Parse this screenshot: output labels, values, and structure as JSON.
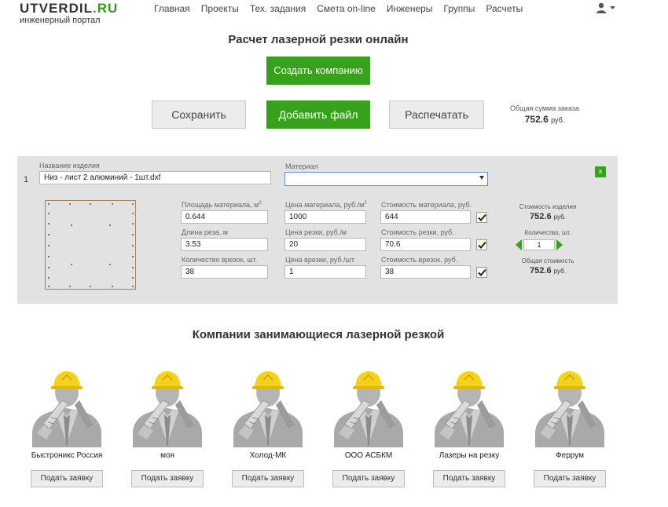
{
  "header": {
    "logo_main": "UTVERDIL",
    "logo_tld": ".RU",
    "logo_sub": "инженерный портал",
    "nav": [
      "Главная",
      "Проекты",
      "Тех. задания",
      "Смета on-line",
      "Инженеры",
      "Группы",
      "Расчеты"
    ]
  },
  "page_title": "Расчет лазерной резки онлайн",
  "buttons": {
    "create_company": "Создать компанию",
    "save": "Сохранить",
    "add_file": "Добавить файл",
    "print": "Распечатать"
  },
  "order_total": {
    "label": "Общая сумма заказа",
    "value": "752.6",
    "unit": "руб."
  },
  "item": {
    "number": "1",
    "name_label": "Название изделия",
    "name_value": "Низ - лист 2 алюминий - 1шт.dxf",
    "material_label": "Материал",
    "material_value": "",
    "close_label": "x",
    "area_label": "Площадь материала, м",
    "area_label_sup": "2",
    "area_value": "0.644",
    "cut_length_label": "Длина реза, м",
    "cut_length_value": "3.53",
    "pierce_count_label": "Количество врезок, шт.",
    "pierce_count_value": "38",
    "material_price_label": "Цена материала, руб./м",
    "material_price_label_sup": "2",
    "material_price_value": "1000",
    "cut_price_label": "Цена резки, руб./м",
    "cut_price_value": "20",
    "pierce_price_label": "Цена врезки, руб./шт.",
    "pierce_price_value": "1",
    "material_cost_label": "Стоимость материала, руб.",
    "material_cost_value": "644",
    "cut_cost_label": "Стоимость резки, руб.",
    "cut_cost_value": "70.6",
    "pierce_cost_label": "Стоимость врезок, руб.",
    "pierce_cost_value": "38",
    "item_cost_label": "Стоимость изделия",
    "item_cost_value": "752.6",
    "quantity_label": "Количество, шт.",
    "quantity_value": "1",
    "total_cost_label": "Общая стоимость",
    "total_cost_value": "752.6",
    "unit": "руб."
  },
  "companies_title": "Компании занимающиеся лазерной резкой",
  "companies": [
    {
      "name": "Быстроникс Россия",
      "button": "Подать заявку"
    },
    {
      "name": "моя",
      "button": "Подать заявку"
    },
    {
      "name": "Холод-МК",
      "button": "Подать заявку"
    },
    {
      "name": "ООО АСБКМ",
      "button": "Подать заявку"
    },
    {
      "name": "Лазеры на резку",
      "button": "Подать заявку"
    },
    {
      "name": "Феррум",
      "button": "Подать заявку"
    }
  ],
  "colors": {
    "accent": "#38a11b",
    "panel": "#e2e2e2"
  }
}
